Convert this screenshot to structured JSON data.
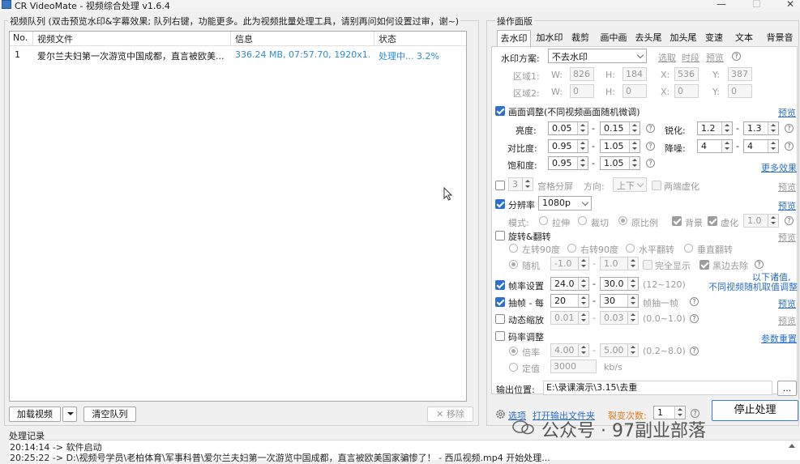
{
  "window": {
    "title": "CR VideoMate - 视频综合处理 v1.6.4",
    "minimize": "—",
    "maximize": "☐",
    "close": "✕"
  },
  "queue": {
    "group_label": "视频队列 (双击预览水印&字幕效果; 队列右键，功能更多。此为视频批量处理工具，请别再问如何设置过审，谢~)",
    "columns": [
      "No.",
      "视频文件",
      "信息",
      "状态"
    ],
    "rows": [
      {
        "no": "1",
        "file": "爱尔兰夫妇第一次游览中国成都，直言被欧美...",
        "info": "336.24 MB, 07:57.70, 1920x1...",
        "status": "处理中... 3.2%"
      }
    ],
    "btn_load": "加载视频",
    "btn_clear": "清空队列",
    "btn_remove": "✕ 移除"
  },
  "ops": {
    "group_label": "操作面版",
    "tabs": [
      "去水印",
      "加水印",
      "裁剪",
      "画中画",
      "去头尾",
      "加头尾",
      "变速",
      "文本",
      "背景音"
    ],
    "watermark_scheme_label": "水印方案:",
    "watermark_scheme_value": "不去水印",
    "links_top": [
      "选取",
      "时段",
      "预览"
    ],
    "region1_label": "区域1:",
    "region2_label": "区域2:",
    "region1": {
      "W": "826",
      "H": "184",
      "X": "536",
      "Y": "387"
    },
    "region2": {
      "W": "0",
      "H": "0",
      "X": "0",
      "Y": "0"
    },
    "W": "W:",
    "H": "H:",
    "X": "X:",
    "Y": "Y:",
    "picture": {
      "label": "画面调整(不同视频画面随机微调)",
      "brightness_label": "亮度:",
      "brightness": [
        "0.05",
        "0.15"
      ],
      "contrast_label": "对比度:",
      "contrast": [
        "0.95",
        "1.05"
      ],
      "saturation_label": "饱和度:",
      "saturation": [
        "0.95",
        "1.05"
      ],
      "sharpen_label": "锐化:",
      "sharpen": [
        "1.2",
        "1.3"
      ],
      "denoise_label": "降噪:",
      "denoise": [
        "4",
        "4"
      ],
      "preview": "预览",
      "more": "更多效果"
    },
    "grid": {
      "count": "3",
      "label": "宫格分屏",
      "dir_label": "方向:",
      "dir_value": "上下",
      "blur_label": "两端虚化",
      "preview": "预览"
    },
    "resolution": {
      "label": "分辨率",
      "value": "1080p",
      "preview": "预览",
      "mode_label": "模式:",
      "modes": [
        "拉伸",
        "裁切",
        "原比例"
      ],
      "bg_label": "背景",
      "blur_label": "虚化",
      "blur_value": "1.0"
    },
    "rotate": {
      "label": "旋转&翻转",
      "preview": "预览",
      "options": [
        "左转90度",
        "右转90度",
        "水平翻转",
        "垂直翻转"
      ],
      "random_label": "随机",
      "rand_vals": [
        "-1.0",
        "1.0"
      ],
      "full_label": "完全显示",
      "black_label": "黑边去除"
    },
    "note_lines": [
      "以下诸值,",
      "不同视频随机取值调整"
    ],
    "framerate": {
      "label": "帧率设置",
      "vals": [
        "24.0",
        "30.0"
      ],
      "range": "(12~120)"
    },
    "extract": {
      "label": "抽帧 - 每",
      "vals": [
        "20",
        "30"
      ],
      "suffix": "帧抽一帧",
      "preview": "预览"
    },
    "zoom": {
      "label": "动态缩放",
      "vals": [
        "0.01",
        "0.03"
      ],
      "range": "(0.0~1.0)",
      "preview": "预览"
    },
    "bitrate": {
      "label": "码率调整",
      "reset": "参数重置",
      "ratio_label": "倍率",
      "ratio_vals": [
        "4.00",
        "5.00"
      ],
      "ratio_range": "(0.2~8.0)",
      "fixed_label": "定值",
      "fixed_val": "3000",
      "unit": "kb/s"
    },
    "help": "?",
    "dash": "-"
  },
  "output": {
    "label": "输出位置:",
    "path": "E:\\录课演示\\3.15\\去重",
    "browse": "..."
  },
  "bottom": {
    "options": "选项",
    "open_folder": "打开输出文件夹",
    "split_label": "裂变次数:",
    "split_value": "1",
    "stop": "停止处理"
  },
  "log": {
    "label": "处理记录",
    "lines": [
      "20:14:14 -> 软件启动",
      "20:25:22 -> D:\\视频号学员\\老柏体育\\军事科普\\爱尔兰夫妇第一次游览中国成都，直言被欧美国家骗惨了！ - 西瓜视频.mp4 开始处理..."
    ]
  },
  "watermark_overlay": "公众号 · 97副业部落"
}
